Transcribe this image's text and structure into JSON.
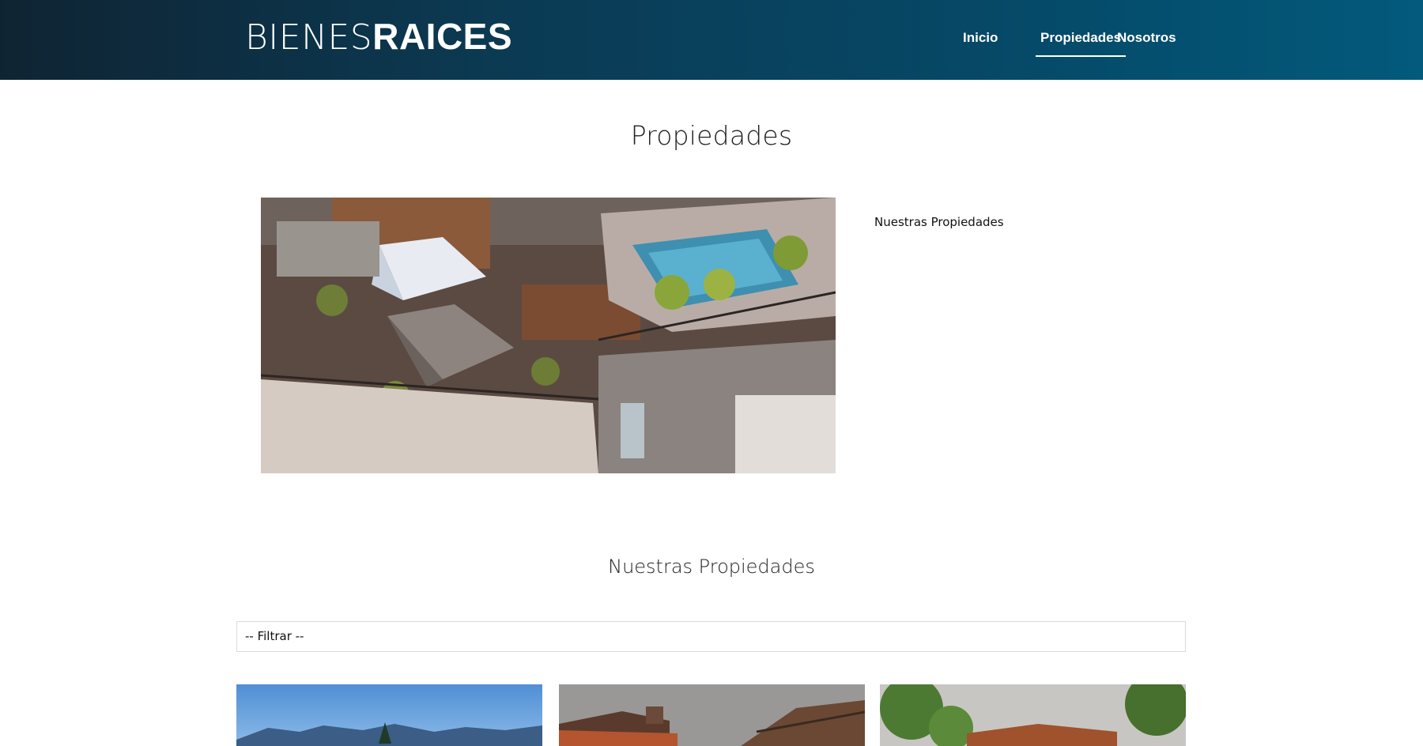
{
  "header": {
    "logo_light": "BIENES",
    "logo_bold": "RAICES",
    "nav": [
      {
        "label": "Inicio",
        "active": false
      },
      {
        "label": "Propiedades",
        "active": true
      },
      {
        "label": "Nosotros",
        "active": false
      }
    ]
  },
  "page": {
    "title": "Propiedades",
    "intro_text": "Nuestras Propiedades"
  },
  "listings": {
    "title": "Nuestras Propiedades",
    "filter": {
      "selected": "-- Filtrar --"
    },
    "cards_visible": 3
  },
  "colors": {
    "header_gradient_start": "#0f2433",
    "header_gradient_end": "#035a7c",
    "background": "#ffffff"
  }
}
